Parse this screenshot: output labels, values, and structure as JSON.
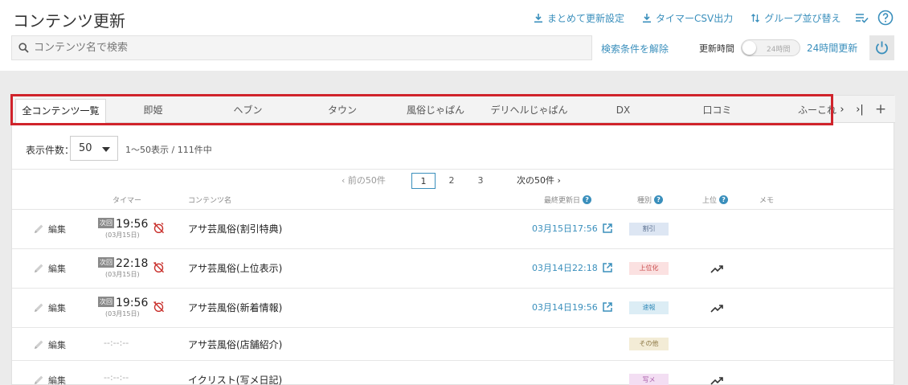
{
  "header": {
    "title": "コンテンツ更新",
    "actions": [
      {
        "label": "まとめて更新設定",
        "icon": "download-icon"
      },
      {
        "label": "タイマーCSV出力",
        "icon": "download-icon"
      },
      {
        "label": "グループ並び替え",
        "icon": "sort-arrows-icon"
      }
    ],
    "list_check_icon": "list-check-icon",
    "help_icon": "help-circle-icon"
  },
  "search": {
    "placeholder": "コンテンツ名で検索",
    "value": "",
    "clear_label": "検索条件を解除"
  },
  "update_time": {
    "label": "更新時間",
    "toggle_text": "24時間",
    "toggle_on": false,
    "mode_label": "24時間更新"
  },
  "tabs": [
    {
      "label": "全コンテンツ一覧",
      "active": true
    },
    {
      "label": "即姫",
      "active": false
    },
    {
      "label": "ヘブン",
      "active": false
    },
    {
      "label": "タウン",
      "active": false
    },
    {
      "label": "風俗じゃぱん",
      "active": false
    },
    {
      "label": "デリヘルじゃぱん",
      "active": false
    },
    {
      "label": "DX",
      "active": false
    },
    {
      "label": "口コミ",
      "active": false
    },
    {
      "label": "ふーこれ",
      "active": false
    }
  ],
  "tab_controls": {
    "next": "›",
    "last": "›|",
    "add": "+"
  },
  "list": {
    "count_label": "表示件数：",
    "count_value": "50",
    "count_info": "1〜50表示 / 111件中"
  },
  "pagination": {
    "prev": "‹ 前の50件",
    "pages": [
      "1",
      "2",
      "3"
    ],
    "current": "1",
    "next": "次の50件 ›"
  },
  "columns": {
    "timer": "タイマー",
    "name": "コンテンツ名",
    "updated": "最終更新日",
    "kind": "種別",
    "rank": "上位",
    "memo": "メモ",
    "help_mark": "?"
  },
  "rows": [
    {
      "edit": "編集",
      "badge": "次回",
      "time": "19:56",
      "date": "(03月15日)",
      "name": "アサ芸風俗(割引特典)",
      "updated": "03月15日17:56",
      "kind": "割引",
      "kind_bg": "#dde6f3",
      "kind_color": "#5a6f8f",
      "rank_icon": false
    },
    {
      "edit": "編集",
      "badge": "次回",
      "time": "22:18",
      "date": "(03月15日)",
      "name": "アサ芸風俗(上位表示)",
      "updated": "03月14日22:18",
      "kind": "上位化",
      "kind_bg": "#fbe1e1",
      "kind_color": "#c94a4a",
      "rank_icon": true
    },
    {
      "edit": "編集",
      "badge": "次回",
      "time": "19:56",
      "date": "(03月15日)",
      "name": "アサ芸風俗(新着情報)",
      "updated": "03月14日19:56",
      "kind": "速報",
      "kind_bg": "#dcedf5",
      "kind_color": "#3a8fbc",
      "rank_icon": true
    },
    {
      "edit": "編集",
      "empty_time": "--:--:--",
      "name": "アサ芸風俗(店舗紹介)",
      "kind": "その他",
      "kind_bg": "#f3ecd6",
      "kind_color": "#8a7440",
      "rank_icon": false
    },
    {
      "edit": "編集",
      "empty_time": "--:--:--",
      "name": "イクリスト(写メ日記)",
      "kind": "写メ",
      "kind_bg": "#f3def3",
      "kind_color": "#a75aa7",
      "rank_icon": true
    }
  ],
  "colors": {
    "accent": "#3a8fbc",
    "highlight": "#d0232b",
    "alarm": "#c9302c"
  }
}
